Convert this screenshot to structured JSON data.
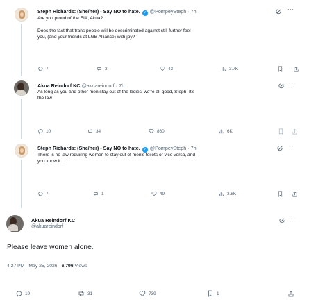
{
  "tweets": [
    {
      "name": "Steph Richards: (She/her) - Say NO to hate.",
      "handle": "@PompeySteph",
      "time": "7h",
      "lines": [
        "Are you proud of the EIA, Akua?",
        "",
        "Does the fact that trans people will be descriminated against still further feel",
        "you, (and your friends at LGB Alliance) with joy?"
      ],
      "stats": {
        "replies": "7",
        "reposts": "3",
        "likes": "43",
        "views": "3.7K"
      }
    },
    {
      "name": "Akua Reindorf KC",
      "handle": "@akuareindorf",
      "time": "7h",
      "lines": [
        "As long as you and other men stay out of the ladies' we're all good, Steph. It's",
        "the law."
      ],
      "stats": {
        "replies": "10",
        "reposts": "34",
        "likes": "860",
        "views": "6K"
      }
    },
    {
      "name": "Steph Richards: (She/her) - Say NO to hate.",
      "handle": "@PompeySteph",
      "time": "7h",
      "lines": [
        "There is no law requiring women to stay out of men's toilets or vice versa, and",
        "you know it."
      ],
      "stats": {
        "replies": "7",
        "reposts": "1",
        "likes": "49",
        "views": "3.8K"
      }
    }
  ],
  "main_tweet": {
    "name": "Akua Reindorf KC",
    "handle": "@akuareindorf",
    "text": "Please leave women alone.",
    "time": "4:27 PM",
    "date": "May 25, 2026",
    "views_count": "6,796",
    "views_label": "Views",
    "stats": {
      "replies": "19",
      "reposts": "31",
      "likes": "739",
      "bookmarks": "1"
    }
  },
  "separators": {
    "dot": "·",
    "more": "···"
  },
  "colors": {
    "accent": "#1d9bf0",
    "secondary_text": "#536471",
    "line": "#cfd9de"
  }
}
